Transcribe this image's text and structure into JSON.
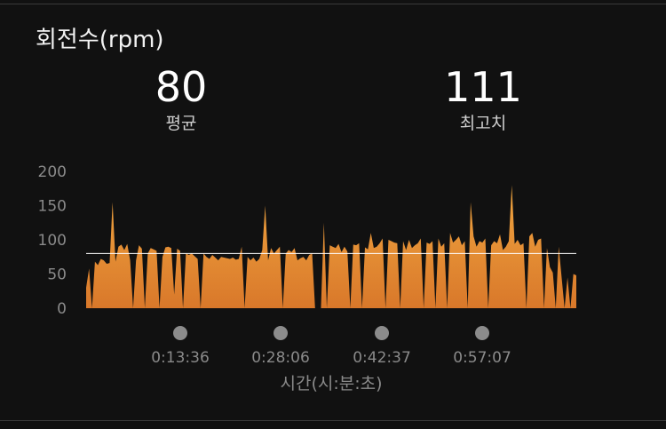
{
  "card": {
    "title": "회전수(rpm)",
    "average": {
      "value": "80",
      "label": "평균"
    },
    "maximum": {
      "value": "111",
      "label": "최고치"
    }
  },
  "colors": {
    "background": "#111111",
    "fill_top": "#f0a640",
    "fill_bottom": "#d9782a",
    "avg_line": "#ffffff",
    "axis_text": "#8a8a8a",
    "marker": "#8c8c8c"
  },
  "chart_data": {
    "type": "area",
    "title": "",
    "xlabel": "시간(시:분:초)",
    "ylabel": "",
    "ylim": [
      0,
      200
    ],
    "yticks": [
      "200",
      "150",
      "100",
      "50",
      "0"
    ],
    "xticks": [
      "0:13:36",
      "0:28:06",
      "0:42:37",
      "0:57:07"
    ],
    "average_line": 80,
    "series": [
      {
        "values": [
          30,
          58,
          0,
          68,
          63,
          72,
          70,
          65,
          66,
          155,
          68,
          90,
          93,
          85,
          94,
          70,
          0,
          70,
          92,
          87,
          0,
          80,
          88,
          86,
          84,
          0,
          75,
          89,
          90,
          88,
          20,
          87,
          84,
          0,
          80,
          78,
          80,
          76,
          72,
          0,
          80,
          75,
          72,
          78,
          74,
          70,
          75,
          74,
          73,
          72,
          74,
          71,
          72,
          90,
          0,
          75,
          70,
          74,
          68,
          72,
          85,
          150,
          70,
          88,
          80,
          85,
          90,
          0,
          80,
          85,
          82,
          88,
          70,
          73,
          75,
          70,
          78,
          80,
          0,
          0,
          0,
          125,
          0,
          92,
          90,
          88,
          94,
          82,
          90,
          83,
          0,
          93,
          92,
          95,
          0,
          89,
          86,
          110,
          88,
          90,
          95,
          102,
          0,
          100,
          98,
          96,
          95,
          0,
          98,
          85,
          100,
          88,
          92,
          95,
          102,
          0,
          96,
          94,
          98,
          0,
          102,
          90,
          95,
          0,
          110,
          96,
          100,
          105,
          92,
          98,
          0,
          155,
          105,
          90,
          98,
          96,
          102,
          0,
          92,
          98,
          95,
          108,
          85,
          90,
          98,
          180,
          94,
          100,
          92,
          95,
          0,
          105,
          110,
          90,
          100,
          102,
          0,
          88,
          60,
          52,
          0,
          90,
          45,
          0,
          45,
          0,
          50,
          48
        ]
      }
    ]
  }
}
